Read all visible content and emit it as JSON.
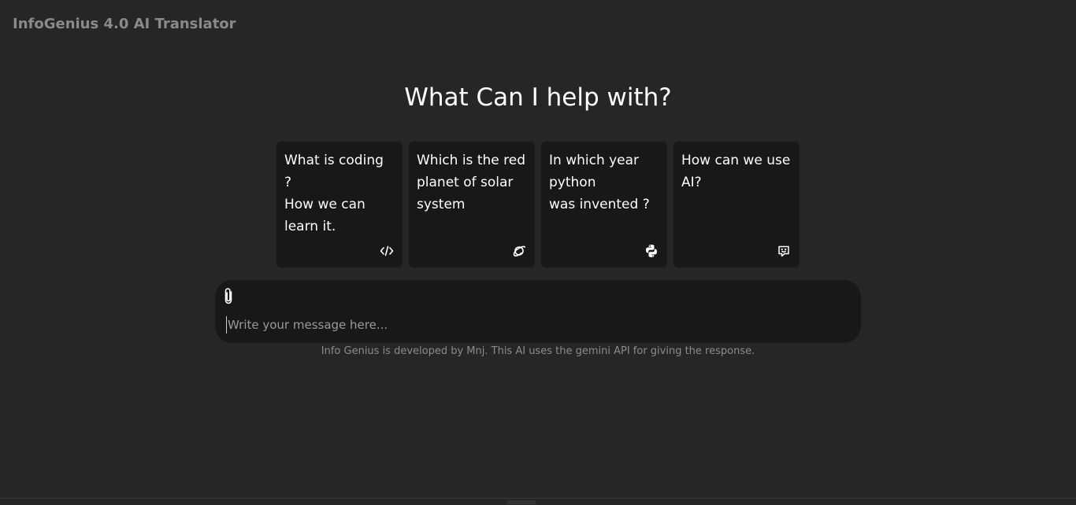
{
  "app": {
    "title": "InfoGenius 4.0 AI Translator"
  },
  "main": {
    "headline": "What Can I help with?",
    "suggestions": [
      {
        "text": "What is coding ?\nHow we can\nlearn it.",
        "icon": "code-icon"
      },
      {
        "text": "Which is the red\nplanet of solar\nsystem",
        "icon": "planet-icon"
      },
      {
        "text": "In which year\npython\nwas invented ?",
        "icon": "python-icon"
      },
      {
        "text": "How can we use\nAI?",
        "icon": "chat-icon"
      }
    ]
  },
  "composer": {
    "attach_icon": "paperclip-icon",
    "placeholder": "Write your message here..."
  },
  "footer": {
    "note": "Info Genius is developed by Mnj. This AI uses the gemini API for giving the response."
  },
  "colors": {
    "background": "#262626",
    "card": "#181818",
    "title": "#8a8a8a",
    "text": "#ffffff",
    "muted": "#8c8c8c"
  }
}
